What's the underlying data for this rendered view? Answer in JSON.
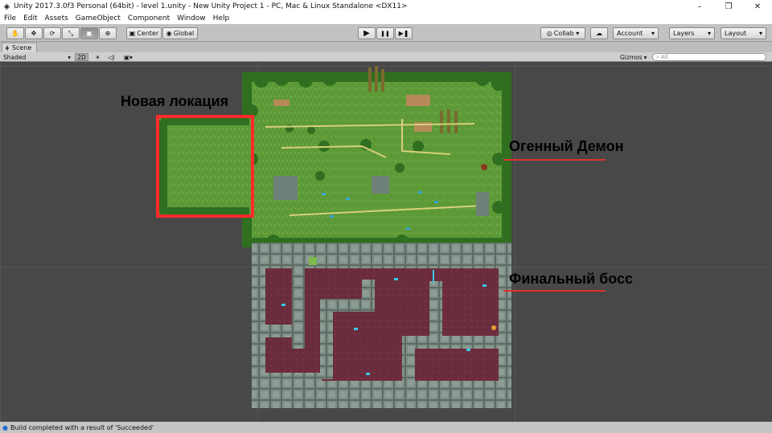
{
  "window": {
    "title": "Unity 2017.3.0f3 Personal (64bit) - level 1.unity - New Unity Project 1 - PC, Mac & Linux Standalone <DX11>",
    "controls": [
      "–",
      "❐",
      "✕"
    ]
  },
  "menu": [
    "File",
    "Edit",
    "Assets",
    "GameObject",
    "Component",
    "Window",
    "Help"
  ],
  "toolbar": {
    "tools": [
      "✋",
      "✥",
      "⟳",
      "⤡",
      "▣",
      "⊕"
    ],
    "center_label": "Center",
    "global_label": "Global",
    "play_controls": [
      "▶",
      "❚❚",
      "▶❚"
    ],
    "collab_label": "Collab ▾",
    "cloud_icon": "☁",
    "account_label": "Account",
    "layers_label": "Layers",
    "layout_label": "Layout"
  },
  "scene_tab": {
    "label": "Scene",
    "shading": "Shaded",
    "mode_2d": "2D",
    "gizmos_label": "Gizmos",
    "search_placeholder": "All"
  },
  "annotations": {
    "new_location": "Новая локация",
    "fire_demon": "Огенный Демон",
    "final_boss": "Финальный босс"
  },
  "status": {
    "message": "Build completed with a result of 'Succeeded'"
  },
  "colors": {
    "grass": "#5e9a38",
    "tree": "#2f6f1f",
    "stone": "#7e8e86",
    "floor": "#6b2d3d",
    "highlight": "#ff2a2a",
    "pointer": "#e0302e"
  }
}
